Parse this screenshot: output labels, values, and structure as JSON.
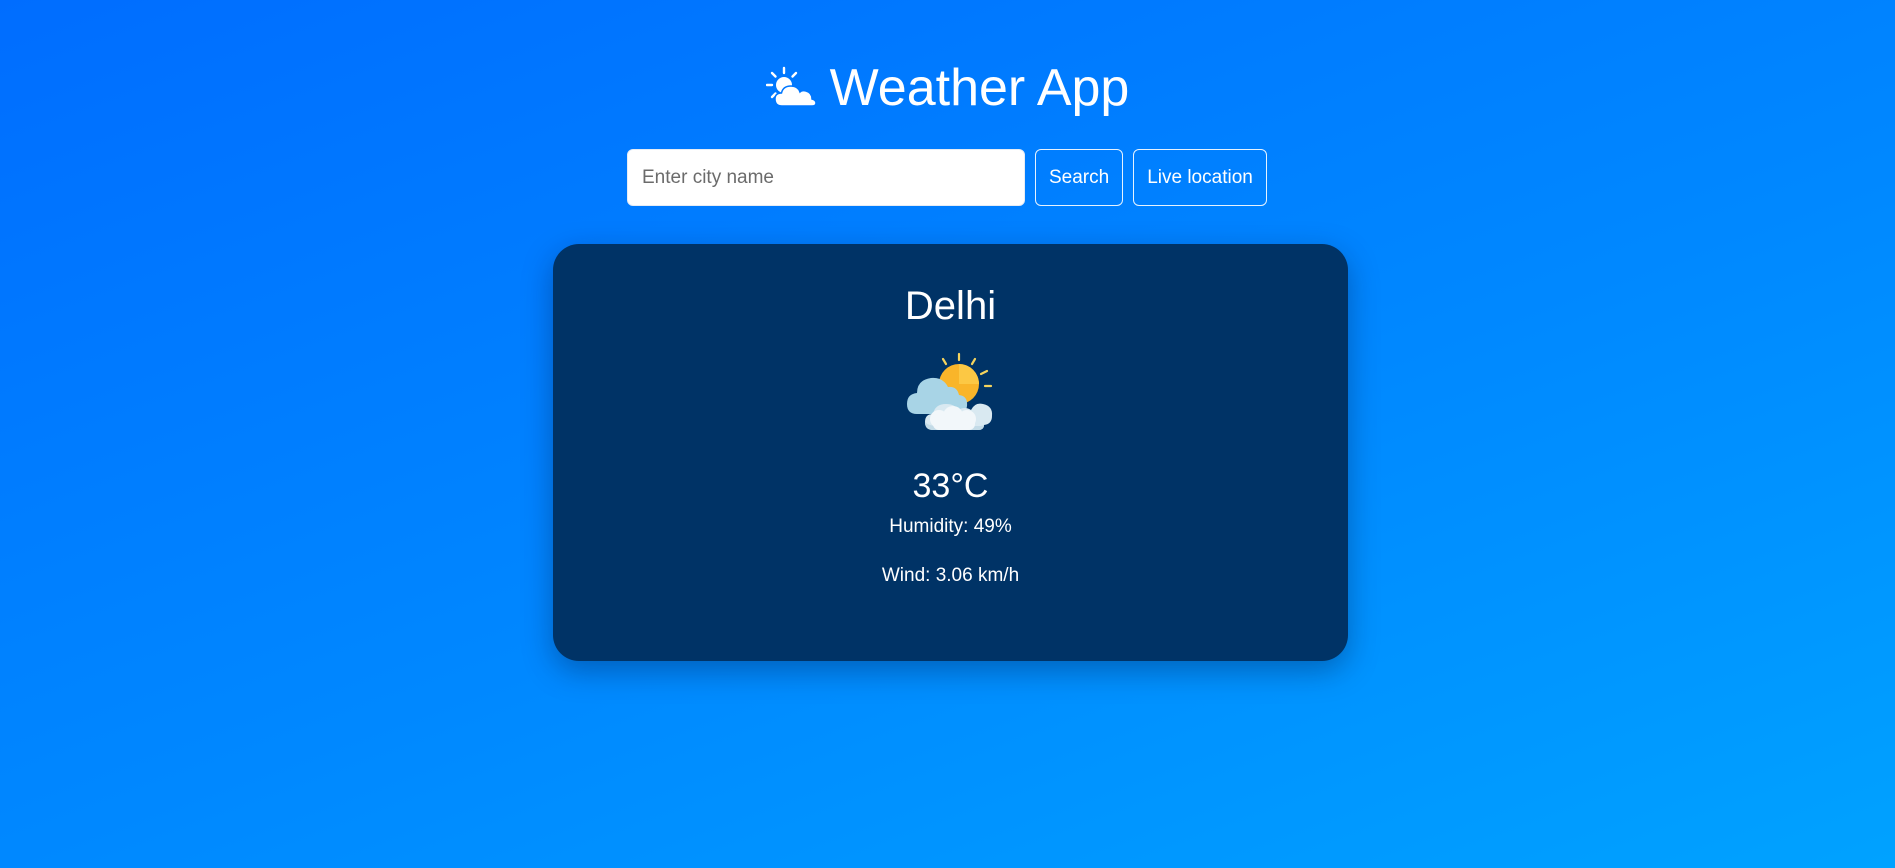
{
  "header": {
    "icon": "sun-behind-cloud-icon",
    "title": "Weather App"
  },
  "search": {
    "placeholder": "Enter city name",
    "value": "",
    "search_label": "Search",
    "live_location_label": "Live location"
  },
  "weather": {
    "city": "Delhi",
    "icon": "sun-behind-clouds-icon",
    "temperature": "33°C",
    "humidity": "Humidity: 49%",
    "wind": "Wind: 3.06 km/h"
  },
  "colors": {
    "background_start": "#006dff",
    "background_end": "#00a2ff",
    "card": "#003366",
    "sun": "#f9b52a",
    "text": "#ffffff"
  }
}
